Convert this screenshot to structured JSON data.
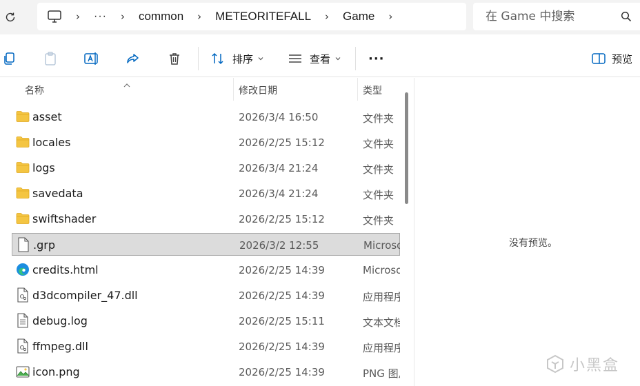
{
  "address_bar": {
    "crumbs": [
      "common",
      "METEORITEFALL",
      "Game"
    ],
    "ellipsis": "···"
  },
  "search": {
    "placeholder": "在 Game 中搜索"
  },
  "toolbar": {
    "sort_label": "排序",
    "view_label": "查看",
    "more_label": "···",
    "preview_label": "预览"
  },
  "columns": {
    "name": "名称",
    "modified": "修改日期",
    "type": "类型"
  },
  "files": [
    {
      "name": "asset",
      "modified": "2026/3/4 16:50",
      "type": "文件夹",
      "icon": "folder-icon"
    },
    {
      "name": "locales",
      "modified": "2026/2/25 15:12",
      "type": "文件夹",
      "icon": "folder-icon"
    },
    {
      "name": "logs",
      "modified": "2026/3/4 21:24",
      "type": "文件夹",
      "icon": "folder-icon"
    },
    {
      "name": "savedata",
      "modified": "2026/3/4 21:24",
      "type": "文件夹",
      "icon": "folder-icon"
    },
    {
      "name": "swiftshader",
      "modified": "2026/2/25 15:12",
      "type": "文件夹",
      "icon": "folder-icon"
    },
    {
      "name": ".grp",
      "modified": "2026/3/2 12:55",
      "type": "Microso",
      "icon": "blank-file-icon",
      "selected": true
    },
    {
      "name": "credits.html",
      "modified": "2026/2/25 14:39",
      "type": "Microso",
      "icon": "edge-icon"
    },
    {
      "name": "d3dcompiler_47.dll",
      "modified": "2026/2/25 14:39",
      "type": "应用程序",
      "icon": "dll-file-icon"
    },
    {
      "name": "debug.log",
      "modified": "2026/2/25 15:11",
      "type": "文本文档",
      "icon": "text-file-icon"
    },
    {
      "name": "ffmpeg.dll",
      "modified": "2026/2/25 14:39",
      "type": "应用程序",
      "icon": "dll-file-icon"
    },
    {
      "name": "icon.png",
      "modified": "2026/2/25 14:39",
      "type": "PNG 图片",
      "icon": "image-file-icon"
    }
  ],
  "preview": {
    "message": "没有预览。"
  },
  "watermark": {
    "text": "小黑盒"
  },
  "colors": {
    "folder": "#f4c542",
    "folder_dark": "#e0a820",
    "accent": "#0067c0",
    "selection": "#dcdcdc"
  }
}
